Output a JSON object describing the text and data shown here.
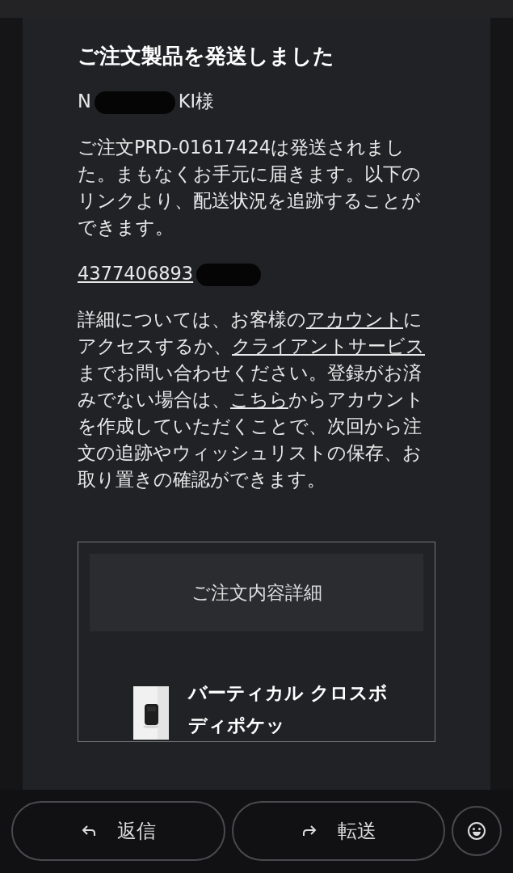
{
  "email": {
    "title": "ご注文製品を発送しました",
    "greeting": {
      "before": "N",
      "after": "KI様"
    },
    "intro": "ご注文PRD-01617424は発送されました。まもなくお手元に届きます。以下のリンクより、配送状況を追跡することができます。",
    "tracking": {
      "visible": "4377406893"
    },
    "details": [
      {
        "kind": "text",
        "text": "詳細については、お客様の"
      },
      {
        "kind": "link",
        "text": "アカウント"
      },
      {
        "kind": "text",
        "text": "にアクセスするか、"
      },
      {
        "kind": "link",
        "text": "クライアントサービス"
      },
      {
        "kind": "text",
        "text": "までお問い合わせください。登録がお済みでない場合は、"
      },
      {
        "kind": "link",
        "text": "こちら"
      },
      {
        "kind": "text",
        "text": "からアカウントを作成していただくことで、次回から注文の追跡やウィッシュリストの保存、お取り置きの確認ができます。"
      }
    ],
    "order": {
      "heading": "ご注文内容詳細",
      "product": {
        "name": "バーティカル クロスボディポケッ"
      }
    }
  },
  "actions": [
    {
      "kind": "reply",
      "label": "返信"
    },
    {
      "kind": "forward",
      "label": "転送"
    },
    {
      "kind": "emoji"
    }
  ]
}
